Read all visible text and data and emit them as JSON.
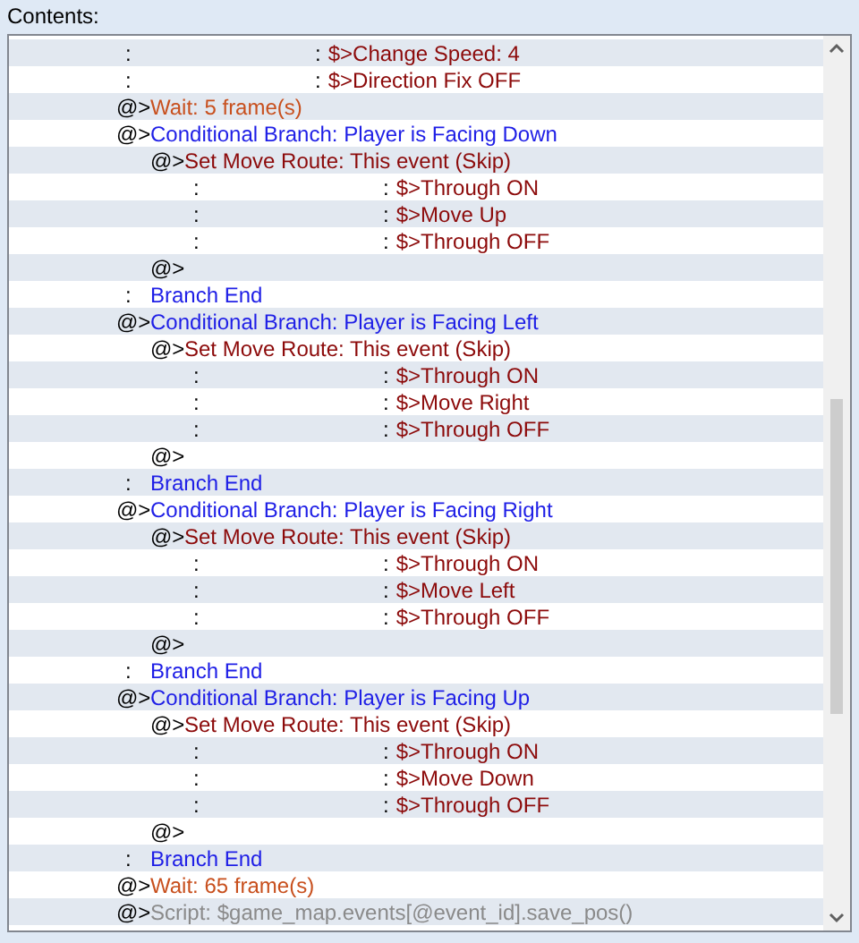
{
  "label": "Contents:",
  "commands": [
    {
      "kind": "route-step",
      "prefix": ":",
      "lead": ":",
      "text": "$>Change Speed: 4"
    },
    {
      "kind": "route-step",
      "prefix": ":",
      "lead": ":",
      "text": "$>Direction Fix OFF"
    },
    {
      "kind": "wait",
      "prefix": "@>",
      "text": "Wait: 5 frame(s)"
    },
    {
      "kind": "branch",
      "prefix": "@>",
      "text": "Conditional Branch: Player is Facing Down",
      "children": [
        {
          "kind": "move-route",
          "prefix": "@>",
          "text": "Set Move Route: This event (Skip)",
          "children": [
            {
              "kind": "route-step",
              "prefix": ":",
              "lead": ":",
              "text": "$>Through ON"
            },
            {
              "kind": "route-step",
              "prefix": ":",
              "lead": ":",
              "text": "$>Move Up"
            },
            {
              "kind": "route-step",
              "prefix": ":",
              "lead": ":",
              "text": "$>Through OFF"
            }
          ]
        },
        {
          "kind": "empty",
          "prefix": "@>"
        }
      ]
    },
    {
      "kind": "branch-end",
      "prefix": ":",
      "text": "Branch End"
    },
    {
      "kind": "branch",
      "prefix": "@>",
      "text": "Conditional Branch: Player is Facing Left",
      "children": [
        {
          "kind": "move-route",
          "prefix": "@>",
          "text": "Set Move Route: This event (Skip)",
          "children": [
            {
              "kind": "route-step",
              "prefix": ":",
              "lead": ":",
              "text": "$>Through ON"
            },
            {
              "kind": "route-step",
              "prefix": ":",
              "lead": ":",
              "text": "$>Move Right"
            },
            {
              "kind": "route-step",
              "prefix": ":",
              "lead": ":",
              "text": "$>Through OFF"
            }
          ]
        },
        {
          "kind": "empty",
          "prefix": "@>"
        }
      ]
    },
    {
      "kind": "branch-end",
      "prefix": ":",
      "text": "Branch End"
    },
    {
      "kind": "branch",
      "prefix": "@>",
      "text": "Conditional Branch: Player is Facing Right",
      "children": [
        {
          "kind": "move-route",
          "prefix": "@>",
          "text": "Set Move Route: This event (Skip)",
          "children": [
            {
              "kind": "route-step",
              "prefix": ":",
              "lead": ":",
              "text": "$>Through ON"
            },
            {
              "kind": "route-step",
              "prefix": ":",
              "lead": ":",
              "text": "$>Move Left"
            },
            {
              "kind": "route-step",
              "prefix": ":",
              "lead": ":",
              "text": "$>Through OFF"
            }
          ]
        },
        {
          "kind": "empty",
          "prefix": "@>"
        }
      ]
    },
    {
      "kind": "branch-end",
      "prefix": ":",
      "text": "Branch End"
    },
    {
      "kind": "branch",
      "prefix": "@>",
      "text": "Conditional Branch: Player is Facing Up",
      "children": [
        {
          "kind": "move-route",
          "prefix": "@>",
          "text": "Set Move Route: This event (Skip)",
          "children": [
            {
              "kind": "route-step",
              "prefix": ":",
              "lead": ":",
              "text": "$>Through ON"
            },
            {
              "kind": "route-step",
              "prefix": ":",
              "lead": ":",
              "text": "$>Move Down"
            },
            {
              "kind": "route-step",
              "prefix": ":",
              "lead": ":",
              "text": "$>Through OFF"
            }
          ]
        },
        {
          "kind": "empty",
          "prefix": "@>"
        }
      ]
    },
    {
      "kind": "branch-end",
      "prefix": ":",
      "text": "Branch End"
    },
    {
      "kind": "wait",
      "prefix": "@>",
      "text": "Wait: 65 frame(s)"
    },
    {
      "kind": "script",
      "prefix": "@>",
      "text": "Script: $game_map.events[@event_id].save_pos()"
    }
  ]
}
